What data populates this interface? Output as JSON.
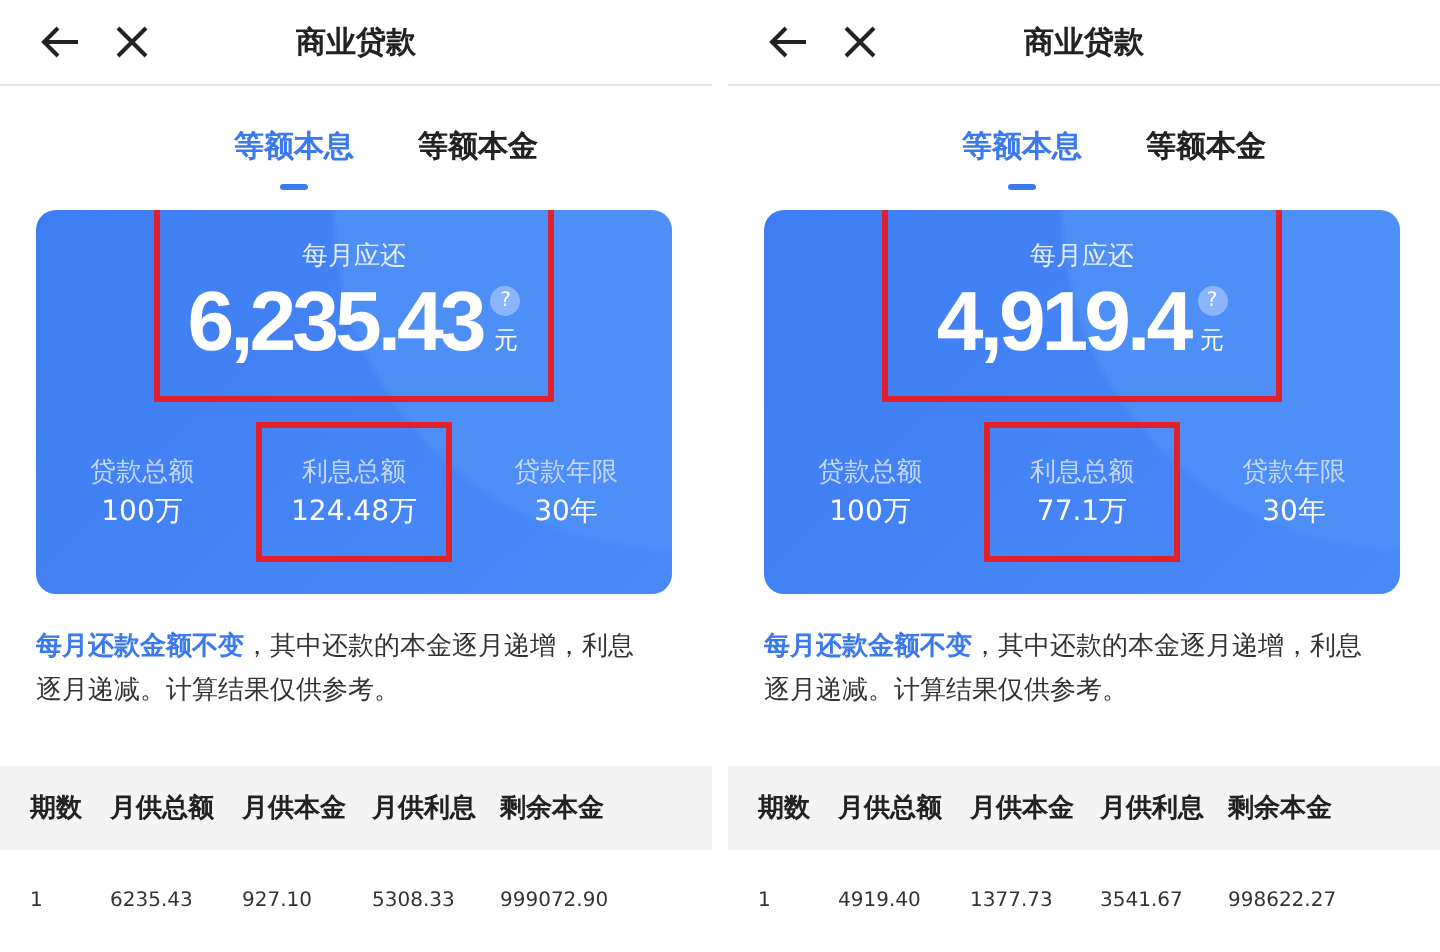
{
  "panels": [
    {
      "title": "商业贷款",
      "tabs": [
        {
          "label": "等额本息",
          "selected": true
        },
        {
          "label": "等额本金",
          "selected": false
        }
      ],
      "card": {
        "monthly_label": "每月应还",
        "monthly_amount": "6,235.43",
        "help": "?",
        "unit": "元",
        "highlighted": true,
        "stats": [
          {
            "label": "贷款总额",
            "value": "100万",
            "highlighted": false
          },
          {
            "label": "利息总额",
            "value": "124.48万",
            "highlighted": true
          },
          {
            "label": "贷款年限",
            "value": "30年",
            "highlighted": false
          }
        ]
      },
      "description": {
        "emphasis": "每月还款金额不变",
        "rest": "，其中还款的本金逐月递增，利息逐月递减。计算结果仅供参考。"
      },
      "table": {
        "columns": [
          "期数",
          "月供总额",
          "月供本金",
          "月供利息",
          "剩余本金"
        ],
        "rows": [
          [
            "1",
            "6235.43",
            "927.10",
            "5308.33",
            "999072.90"
          ]
        ]
      }
    },
    {
      "title": "商业贷款",
      "tabs": [
        {
          "label": "等额本息",
          "selected": true
        },
        {
          "label": "等额本金",
          "selected": false
        }
      ],
      "card": {
        "monthly_label": "每月应还",
        "monthly_amount": "4,919.4",
        "help": "?",
        "unit": "元",
        "highlighted": true,
        "stats": [
          {
            "label": "贷款总额",
            "value": "100万",
            "highlighted": false
          },
          {
            "label": "利息总额",
            "value": "77.1万",
            "highlighted": true
          },
          {
            "label": "贷款年限",
            "value": "30年",
            "highlighted": false
          }
        ]
      },
      "description": {
        "emphasis": "每月还款金额不变",
        "rest": "，其中还款的本金逐月递增，利息逐月递减。计算结果仅供参考。"
      },
      "table": {
        "columns": [
          "期数",
          "月供总额",
          "月供本金",
          "月供利息",
          "剩余本金"
        ],
        "rows": [
          [
            "1",
            "4919.40",
            "1377.73",
            "3541.67",
            "998622.27"
          ]
        ]
      }
    }
  ]
}
